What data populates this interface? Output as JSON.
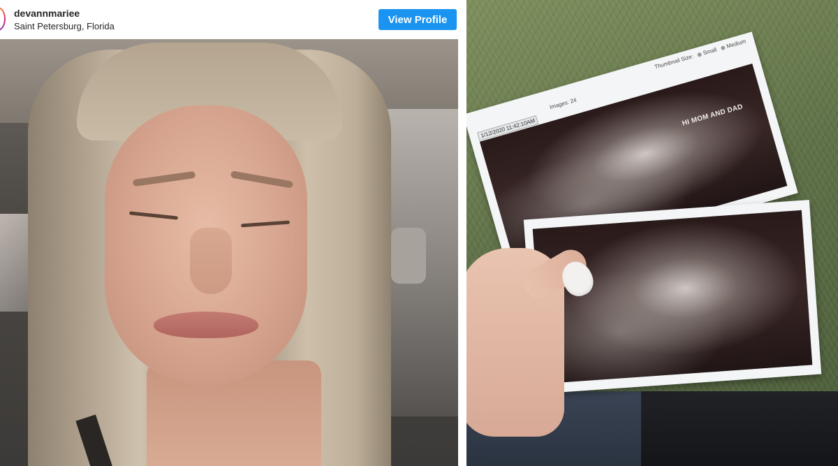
{
  "post_header": {
    "username": "devannmariee",
    "location": "Saint Petersburg, Florida",
    "view_profile_label": "View Profile"
  },
  "colors": {
    "view_profile_button": "#1a94f0",
    "header_text": "#262626"
  },
  "ultrasound": {
    "thumbnail_size_label": "Thumbnail Size:",
    "size_small": "Small",
    "size_medium": "Medium",
    "images_label": "Images: 24",
    "timestamp": "1/12/2020 11:42:10AM",
    "caption": "HI MOM AND DAD"
  },
  "icons": {
    "avatar": "profile-avatar-ring"
  }
}
